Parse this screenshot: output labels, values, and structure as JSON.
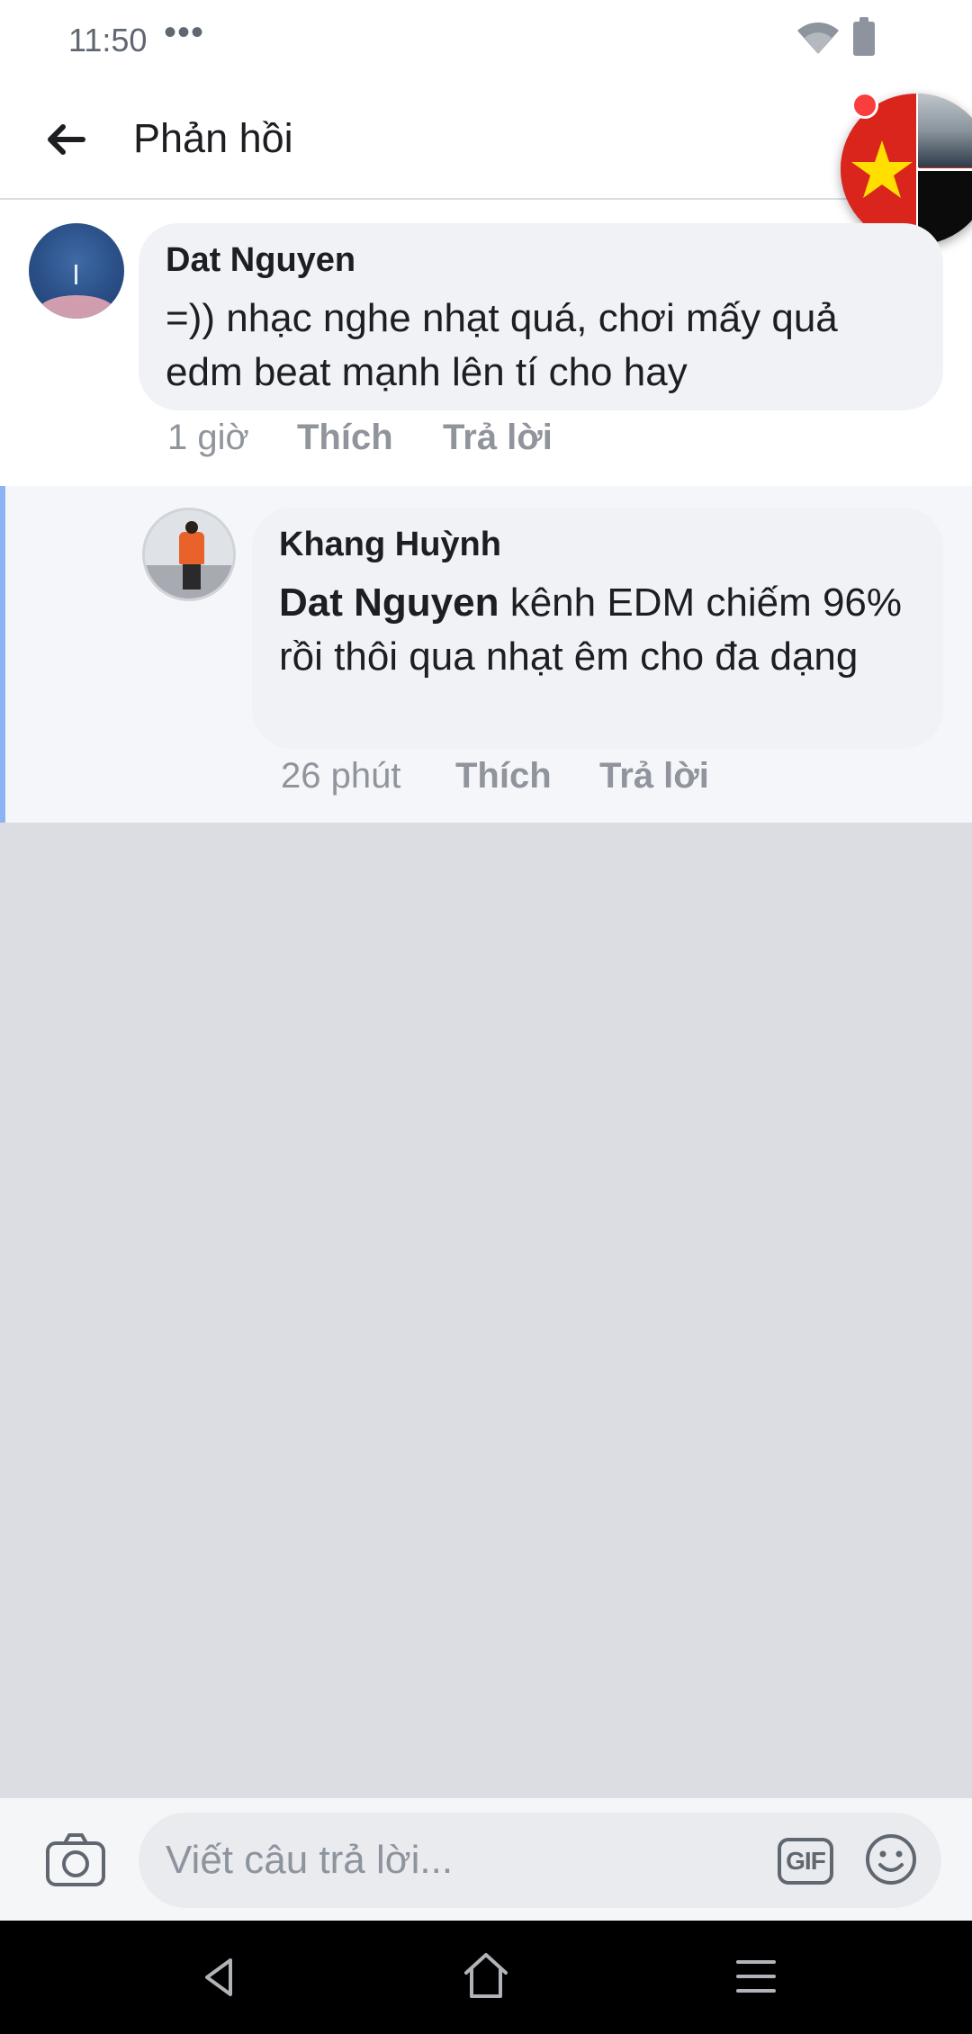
{
  "status_bar": {
    "time": "11:50",
    "dots": "•••"
  },
  "header": {
    "title": "Phản hồi"
  },
  "comment": {
    "author": "Dat Nguyen",
    "text": "=)) nhạc nghe nhạt quá, chơi mấy quả edm beat mạnh lên tí cho hay",
    "time": "1 giờ",
    "like_label": "Thích",
    "reply_label": "Trả lời"
  },
  "reply": {
    "author": "Khang Huỳnh",
    "mention": "Dat Nguyen",
    "text": " kênh EDM chiếm 96% rồi thôi qua nhạt êm cho đa dạng",
    "time": "26 phút",
    "like_label": "Thích",
    "reply_label": "Trả lời"
  },
  "composer": {
    "placeholder": "Viết câu trả lời...",
    "gif_label": "GIF"
  },
  "colors": {
    "reply_highlight": "#8db3f5",
    "bubble_bg": "#f0f2f5",
    "meta_text": "#90949c"
  }
}
